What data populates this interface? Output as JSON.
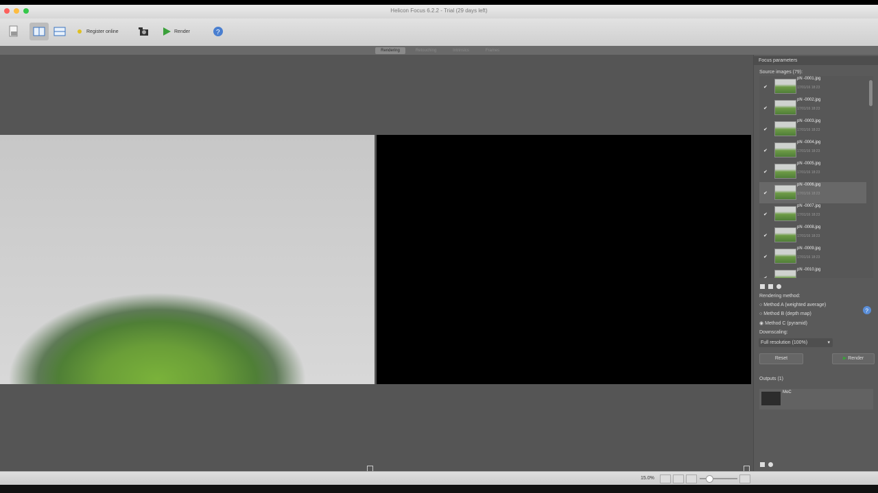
{
  "window": {
    "title": "Helicon Focus 6.2.2 - Trial (29 days left)"
  },
  "traffic_colors": {
    "close": "#fc605c",
    "minimize": "#fdbc40",
    "zoom": "#34c84a"
  },
  "toolbar": {
    "register_label": "Register online",
    "render_label": "Render"
  },
  "tabs": [
    "Rendering",
    "Retouching",
    "Intrinsics",
    "Frames"
  ],
  "panel": {
    "title": "Focus parameters",
    "source_images_label": "Source images (79):",
    "source_images": [
      {
        "name": "pN -0001.jpg",
        "date": "17/01/16 18:23",
        "checked": true
      },
      {
        "name": "pN -0002.jpg",
        "date": "17/01/16 18:23",
        "checked": true
      },
      {
        "name": "pN -0003.jpg",
        "date": "17/01/16 18:23",
        "checked": true
      },
      {
        "name": "pN -0004.jpg",
        "date": "17/01/16 18:23",
        "checked": true
      },
      {
        "name": "pN -0005.jpg",
        "date": "17/01/16 18:23",
        "checked": true
      },
      {
        "name": "pN -0006.jpg",
        "date": "17/01/16 18:23",
        "checked": true
      },
      {
        "name": "pN -0007.jpg",
        "date": "17/01/16 18:23",
        "checked": true
      },
      {
        "name": "pN -0008.jpg",
        "date": "17/01/16 18:23",
        "checked": true
      },
      {
        "name": "pN -0009.jpg",
        "date": "17/01/16 18:23",
        "checked": true
      },
      {
        "name": "pN -0010.jpg",
        "date": "",
        "checked": true
      }
    ],
    "rendering_method_label": "Rendering method:",
    "methods": [
      "Method A (weighted average)",
      "Method B (depth map)",
      "Method C (pyramid)"
    ],
    "selected_method": "Method C (pyramid)",
    "downscaling_label": "Downscaling:",
    "downscaling_value": "Full resolution (100%)",
    "reset_label": "Reset",
    "render_label": "Render",
    "outputs_label": "Outputs (1)",
    "output_name": "MoC"
  },
  "statusbar": {
    "zoom": "15.0%"
  }
}
